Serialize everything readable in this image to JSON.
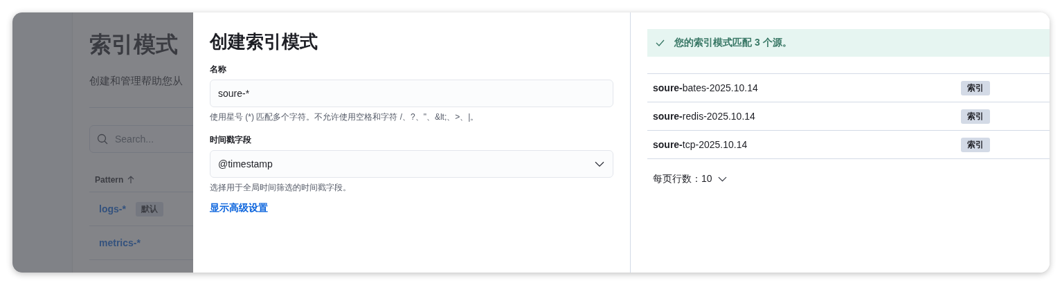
{
  "background_page": {
    "title": "索引模式",
    "subtitle": "创建和管理帮助您从",
    "search": {
      "placeholder": "Search..."
    },
    "table": {
      "columns": [
        {
          "label": "Pattern",
          "sorted": true
        }
      ],
      "rows": [
        {
          "pattern": "logs-*",
          "badge": "默认"
        },
        {
          "pattern": "metrics-*"
        }
      ]
    }
  },
  "flyout": {
    "title": "创建索引模式",
    "fields": [
      {
        "kind": "text",
        "label": "名称",
        "value": "soure-*",
        "help": "使用星号 (*) 匹配多个字符。不允许使用空格和字符 /、?、\"、&lt;、>、|。"
      },
      {
        "kind": "select",
        "label": "时间戳字段",
        "value": "@timestamp",
        "help": "选择用于全局时间筛选的时间戳字段。"
      }
    ],
    "advanced_link": "显示高级设置",
    "callout": "您的索引模式匹配 3 个源。",
    "sources": [
      {
        "name": "**soure-**bates-2025.10.14",
        "type": "索引"
      },
      {
        "name": "**soure-**redis-2025.10.14",
        "type": "索引"
      },
      {
        "name": "**soure-**tcp-2025.10.14",
        "type": "索引"
      }
    ],
    "rows_per_page": "每页行数：10"
  }
}
